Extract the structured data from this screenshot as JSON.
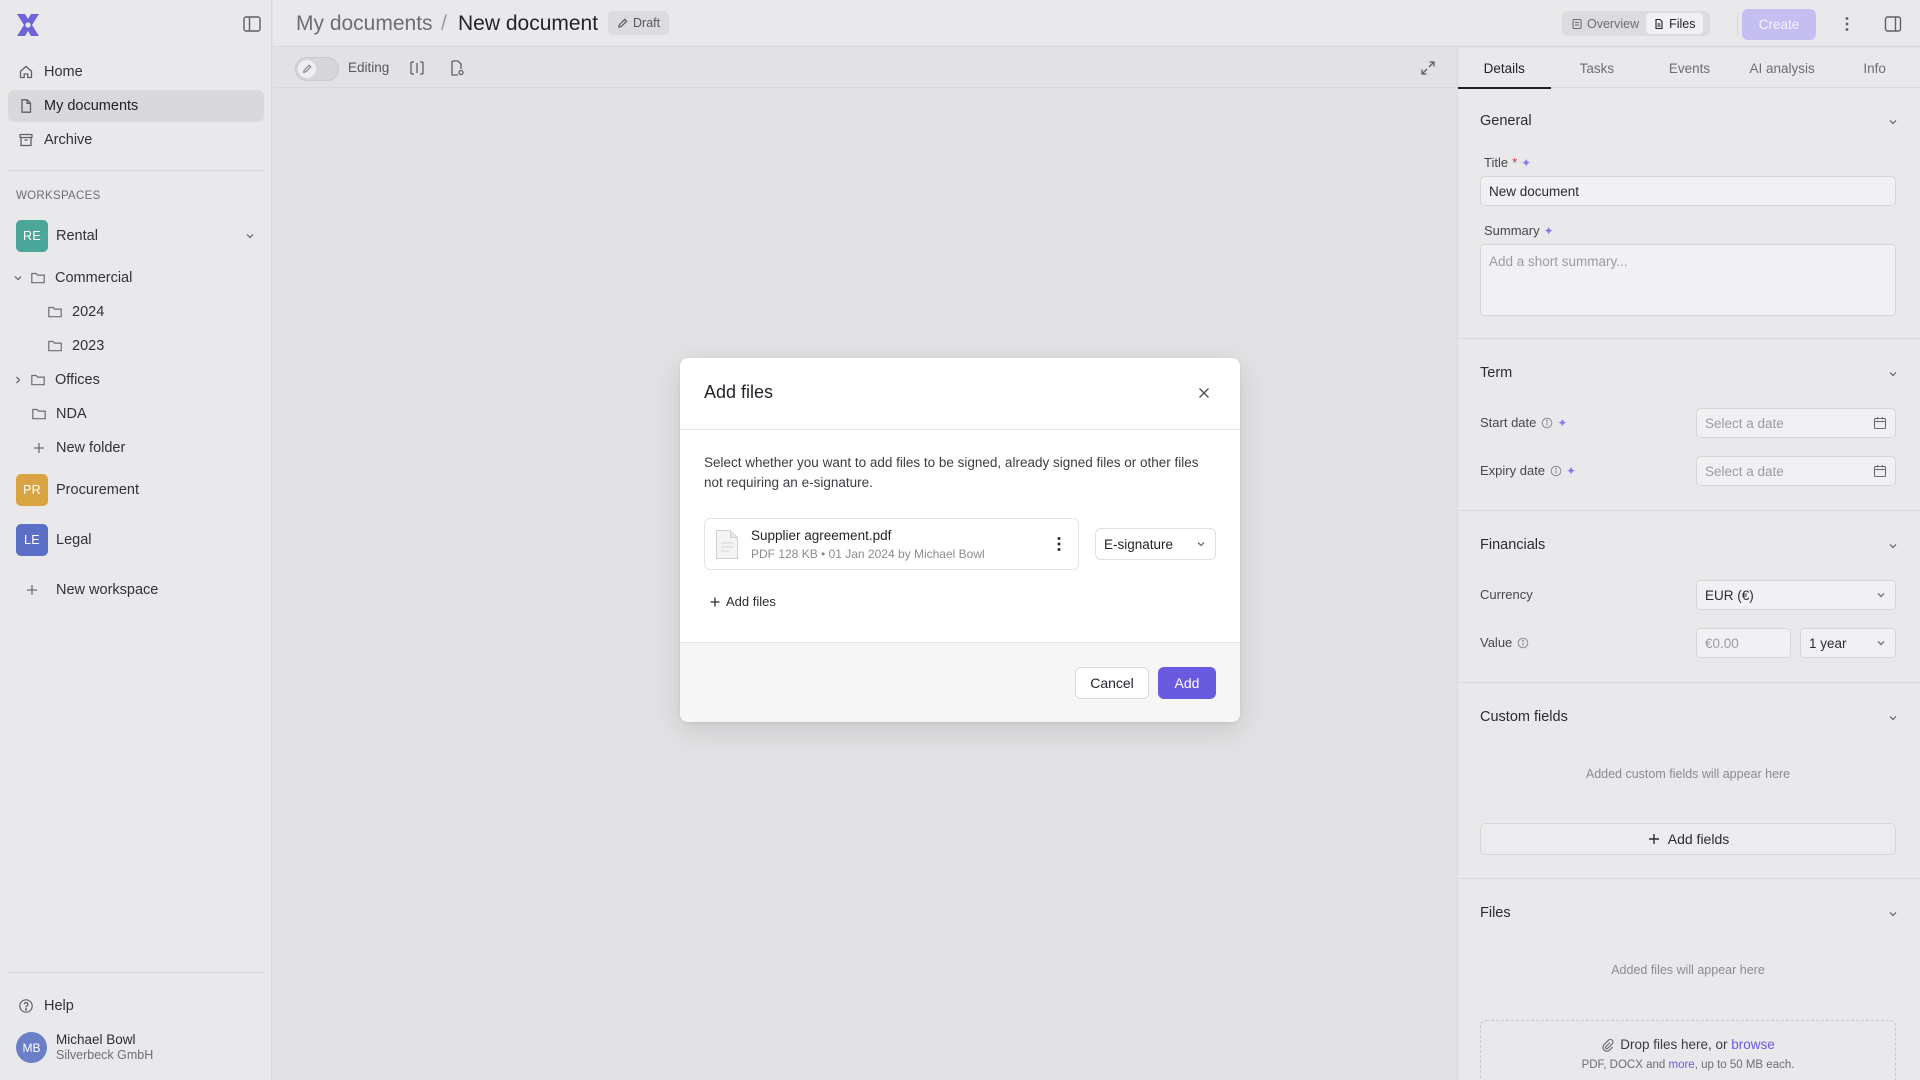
{
  "sidebar": {
    "nav": [
      {
        "label": "Home",
        "icon": "home-icon"
      },
      {
        "label": "My documents",
        "icon": "document-icon",
        "active": true
      },
      {
        "label": "Archive",
        "icon": "archive-icon"
      }
    ],
    "workspaces_label": "WORKSPACES",
    "workspaces": [
      {
        "abbr": "RE",
        "name": "Rental",
        "color": "#4aa79a"
      },
      {
        "abbr": "PR",
        "name": "Procurement",
        "color": "#d9a441"
      },
      {
        "abbr": "LE",
        "name": "Legal",
        "color": "#5b6fc7"
      }
    ],
    "tree": {
      "commercial": "Commercial",
      "y2024": "2024",
      "y2023": "2023",
      "offices": "Offices",
      "nda": "NDA",
      "new_folder": "New folder"
    },
    "new_workspace": "New workspace",
    "help": "Help",
    "user": {
      "initials": "MB",
      "name": "Michael Bowl",
      "company": "Silverbeck GmbH"
    }
  },
  "header": {
    "crumb_parent": "My documents",
    "crumb_sep": "/",
    "crumb_current": "New document",
    "status": "Draft",
    "view_overview": "Overview",
    "view_files": "Files",
    "create": "Create"
  },
  "toolbar": {
    "mode_label": "Editing"
  },
  "panel": {
    "tabs": [
      "Details",
      "Tasks",
      "Events",
      "AI analysis",
      "Info"
    ],
    "general": {
      "title": "General",
      "title_label": "Title",
      "title_required": "*",
      "title_value": "New document",
      "summary_label": "Summary",
      "summary_placeholder": "Add a short summary..."
    },
    "term": {
      "title": "Term",
      "start_label": "Start date",
      "start_placeholder": "Select a date",
      "expiry_label": "Expiry date",
      "expiry_placeholder": "Select a date"
    },
    "financials": {
      "title": "Financials",
      "currency_label": "Currency",
      "currency_value": "EUR (€)",
      "value_label": "Value",
      "value_placeholder": "€0.00",
      "period_value": "1 year"
    },
    "custom_fields": {
      "title": "Custom fields",
      "hint": "Added custom fields will appear here",
      "add_button": "Add fields"
    },
    "files": {
      "title": "Files",
      "hint": "Added files will appear here",
      "drop_text": "Drop files here, or",
      "browse": "browse",
      "formats_pre": "PDF, DOCX and",
      "formats_more": "more",
      "formats_post": ", up to 50 MB each."
    }
  },
  "modal": {
    "title": "Add files",
    "description": "Select whether you want to add files to be signed, already signed files or other files not requiring an e-signature.",
    "file": {
      "name": "Supplier agreement.pdf",
      "meta": "PDF 128 KB • 01 Jan 2024 by Michael Bowl",
      "type": "E-signature"
    },
    "add_files": "Add files",
    "cancel": "Cancel",
    "add": "Add"
  },
  "colors": {
    "accent": "#6a5adf",
    "accent_disabled": "#c4bff0",
    "required": "#8b7bf0"
  }
}
